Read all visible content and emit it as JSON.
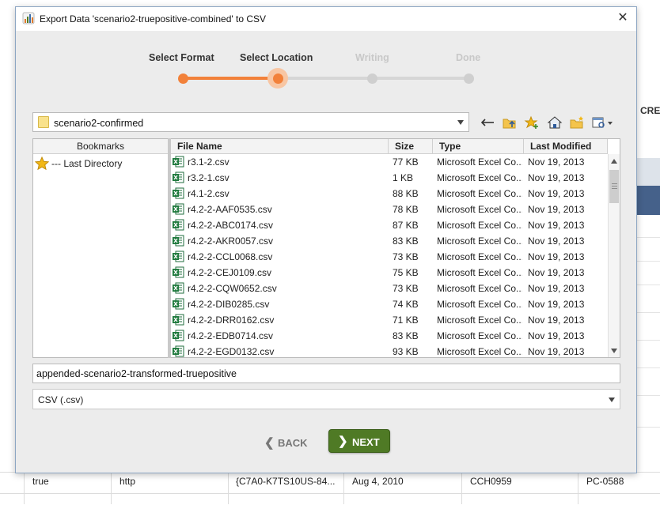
{
  "dialog": {
    "title": "Export Data 'scenario2-truepositive-combined' to CSV",
    "close_glyph": "✕"
  },
  "steps": [
    {
      "label": "Select Format",
      "state": "done"
    },
    {
      "label": "Select Location",
      "state": "current"
    },
    {
      "label": "Writing",
      "state": "pending"
    },
    {
      "label": "Done",
      "state": "pending"
    }
  ],
  "location": {
    "current_folder": "scenario2-confirmed"
  },
  "toolbar": {
    "icons": [
      "back-arrow-icon",
      "folder-up-icon",
      "add-bookmark-icon",
      "home-icon",
      "new-folder-icon",
      "view-options-icon"
    ]
  },
  "bookmarks": {
    "header": "Bookmarks",
    "items": [
      {
        "label": "--- Last Directory",
        "icon": "star-icon"
      }
    ]
  },
  "files": {
    "columns": [
      "File Name",
      "Size",
      "Type",
      "Last Modified"
    ],
    "rows": [
      {
        "name": "r3.1-2.csv",
        "size": "77 KB",
        "type": "Microsoft Excel Co...",
        "modified": "Nov 19, 2013"
      },
      {
        "name": "r3.2-1.csv",
        "size": "1 KB",
        "type": "Microsoft Excel Co...",
        "modified": "Nov 19, 2013"
      },
      {
        "name": "r4.1-2.csv",
        "size": "88 KB",
        "type": "Microsoft Excel Co...",
        "modified": "Nov 19, 2013"
      },
      {
        "name": "r4.2-2-AAF0535.csv",
        "size": "78 KB",
        "type": "Microsoft Excel Co...",
        "modified": "Nov 19, 2013"
      },
      {
        "name": "r4.2-2-ABC0174.csv",
        "size": "87 KB",
        "type": "Microsoft Excel Co...",
        "modified": "Nov 19, 2013"
      },
      {
        "name": "r4.2-2-AKR0057.csv",
        "size": "83 KB",
        "type": "Microsoft Excel Co...",
        "modified": "Nov 19, 2013"
      },
      {
        "name": "r4.2-2-CCL0068.csv",
        "size": "73 KB",
        "type": "Microsoft Excel Co...",
        "modified": "Nov 19, 2013"
      },
      {
        "name": "r4.2-2-CEJ0109.csv",
        "size": "75 KB",
        "type": "Microsoft Excel Co...",
        "modified": "Nov 19, 2013"
      },
      {
        "name": "r4.2-2-CQW0652.csv",
        "size": "73 KB",
        "type": "Microsoft Excel Co...",
        "modified": "Nov 19, 2013"
      },
      {
        "name": "r4.2-2-DIB0285.csv",
        "size": "74 KB",
        "type": "Microsoft Excel Co...",
        "modified": "Nov 19, 2013"
      },
      {
        "name": "r4.2-2-DRR0162.csv",
        "size": "71 KB",
        "type": "Microsoft Excel Co...",
        "modified": "Nov 19, 2013"
      },
      {
        "name": "r4.2-2-EDB0714.csv",
        "size": "83 KB",
        "type": "Microsoft Excel Co...",
        "modified": "Nov 19, 2013"
      },
      {
        "name": "r4.2-2-EGD0132.csv",
        "size": "93 KB",
        "type": "Microsoft Excel Co...",
        "modified": "Nov 19, 2013"
      }
    ]
  },
  "filename": {
    "value": "appended-scenario2-transformed-truepositive"
  },
  "format": {
    "selected": "CSV (.csv)"
  },
  "buttons": {
    "back_label": "BACK",
    "next_label": "NEXT",
    "back_glyph": "❮",
    "next_glyph": "❯"
  },
  "background": {
    "header_fragment": "CRE",
    "row": [
      "true",
      "http",
      "{C7A0-K7TS10US-84...",
      "Aug 4, 2010",
      "CCH0959",
      "PC-0588"
    ]
  },
  "colors": {
    "accent_orange": "#f2813a",
    "next_green": "#4f7a25",
    "step_inactive": "#cfcfcf",
    "titlebar_border": "#8da6c3"
  }
}
